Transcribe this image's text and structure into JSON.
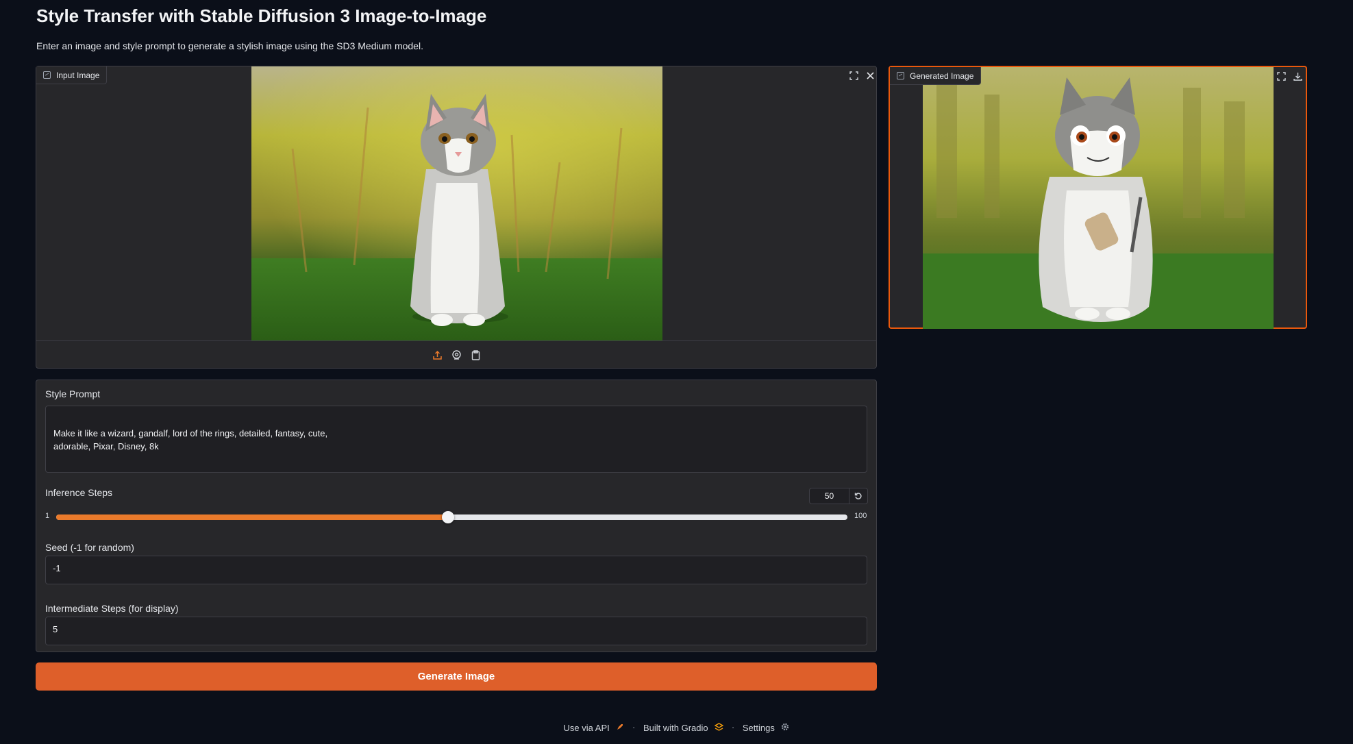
{
  "header": {
    "title": "Style Transfer with Stable Diffusion 3 Image-to-Image",
    "subtitle": "Enter an image and style prompt to generate a stylish image using the SD3 Medium model."
  },
  "input_image": {
    "label": "Input Image",
    "icons": [
      "fullscreen-icon",
      "close-icon",
      "upload-icon",
      "webcam-icon",
      "clipboard-icon"
    ]
  },
  "output_image": {
    "label": "Generated Image",
    "icons": [
      "fullscreen-icon",
      "download-icon"
    ]
  },
  "style_prompt": {
    "label": "Style Prompt",
    "value": "Make it like a wizard, gandalf, lord of the rings, detailed, fantasy, cute,\nadorable, Pixar, Disney, 8k"
  },
  "inference_steps": {
    "label": "Inference Steps",
    "value": "50",
    "min": "1",
    "max": "100",
    "fraction": 0.495
  },
  "seed": {
    "label": "Seed (-1 for random)",
    "value": "-1"
  },
  "intermediate_steps": {
    "label": "Intermediate Steps (for display)",
    "value": "5"
  },
  "generate_button": {
    "label": "Generate Image"
  },
  "footer": {
    "api": "Use via API",
    "built": "Built with Gradio",
    "settings": "Settings",
    "separator": "·"
  },
  "colors": {
    "accent": "#ea580c",
    "button": "#de5f2a",
    "background": "#0b0f19"
  }
}
